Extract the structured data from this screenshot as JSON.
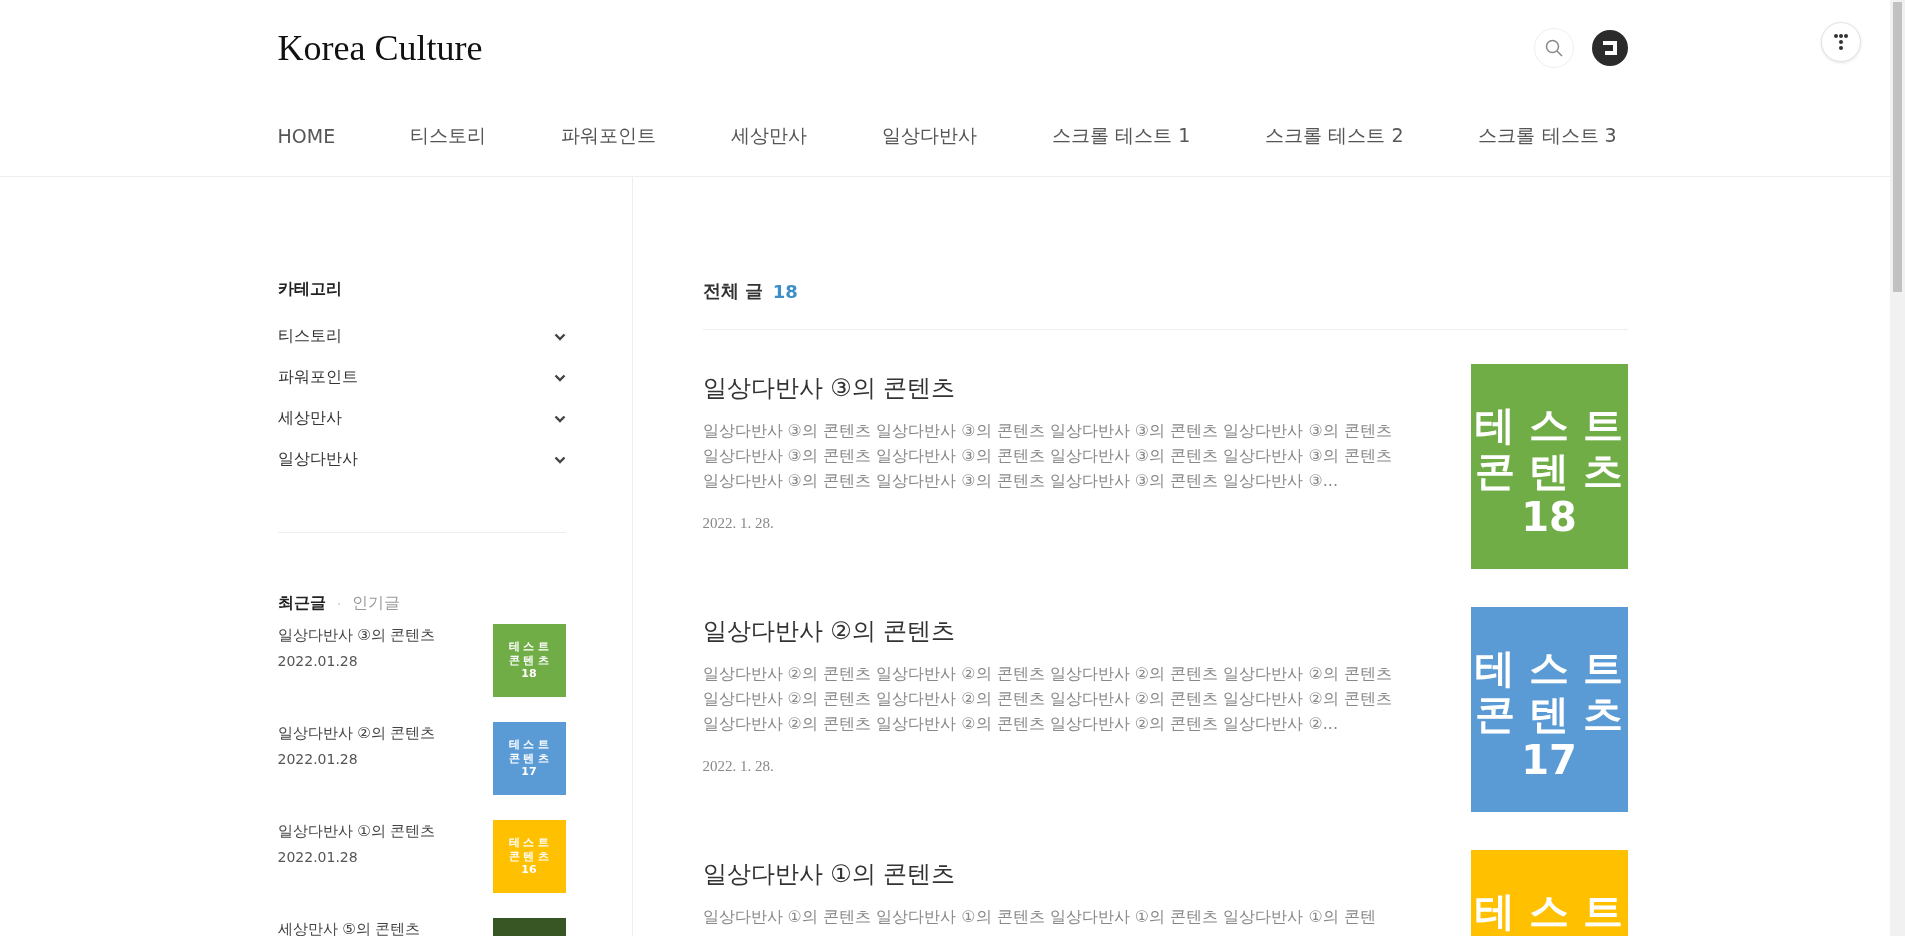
{
  "blog": {
    "title": "Korea Culture"
  },
  "nav": [
    {
      "label": "HOME"
    },
    {
      "label": "티스토리"
    },
    {
      "label": "파워포인트"
    },
    {
      "label": "세상만사"
    },
    {
      "label": "일상다반사"
    },
    {
      "label": "스크롤 테스트 1"
    },
    {
      "label": "스크롤 테스트 2"
    },
    {
      "label": "스크롤 테스트 3"
    }
  ],
  "sidebar": {
    "category_heading": "카테고리",
    "categories": [
      {
        "label": "티스토리"
      },
      {
        "label": "파워포인트"
      },
      {
        "label": "세상만사"
      },
      {
        "label": "일상다반사"
      }
    ],
    "tabs": [
      {
        "label": "최근글",
        "selected": true
      },
      {
        "label": "인기글",
        "selected": false
      }
    ],
    "recent_posts": [
      {
        "title": "일상다반사 ③의 콘텐츠",
        "date": "2022.01.28",
        "thumb": {
          "color": "#70ad47",
          "lines": [
            "테 스 트",
            "콘 텐 츠",
            "18"
          ]
        }
      },
      {
        "title": "일상다반사 ②의 콘텐츠",
        "date": "2022.01.28",
        "thumb": {
          "color": "#5b9bd5",
          "lines": [
            "테 스 트",
            "콘 텐 츠",
            "17"
          ]
        }
      },
      {
        "title": "일상다반사 ①의 콘텐츠",
        "date": "2022.01.28",
        "thumb": {
          "color": "#ffc000",
          "lines": [
            "테 스 트",
            "콘 텐 츠",
            "16"
          ]
        }
      },
      {
        "title": "세상만사 ⑤의 콘텐츠",
        "thumb": {
          "color": "#375623"
        }
      }
    ]
  },
  "main": {
    "heading": "전체 글",
    "count": "18",
    "posts": [
      {
        "title": "일상다반사 ③의 콘텐츠",
        "excerpt": "일상다반사 ③의 콘텐츠 일상다반사 ③의 콘텐츠 일상다반사 ③의 콘텐츠 일상다반사 ③의 콘텐츠 일상다반사 ③의 콘텐츠 일상다반사 ③의 콘텐츠 일상다반사 ③의 콘텐츠 일상다반사 ③의 콘텐츠 일상다반사 ③의 콘텐츠 일상다반사 ③의 콘텐츠 일상다반사 ③의 콘텐츠 일상다반사 ③...",
        "date": "2022. 1. 28.",
        "thumb": {
          "color": "#70ad47",
          "lines": [
            "테 스 트",
            "콘 텐 츠",
            "18"
          ]
        }
      },
      {
        "title": "일상다반사 ②의 콘텐츠",
        "excerpt": "일상다반사 ②의 콘텐츠 일상다반사 ②의 콘텐츠 일상다반사 ②의 콘텐츠 일상다반사 ②의 콘텐츠 일상다반사 ②의 콘텐츠 일상다반사 ②의 콘텐츠 일상다반사 ②의 콘텐츠 일상다반사 ②의 콘텐츠 일상다반사 ②의 콘텐츠 일상다반사 ②의 콘텐츠 일상다반사 ②의 콘텐츠 일상다반사 ②...",
        "date": "2022. 1. 28.",
        "thumb": {
          "color": "#5b9bd5",
          "lines": [
            "테 스 트",
            "콘 텐 츠",
            "17"
          ]
        }
      },
      {
        "title": "일상다반사 ①의 콘텐츠",
        "excerpt": "일상다반사 ①의 콘텐츠 일상다반사 ①의 콘텐츠 일상다반사 ①의 콘텐츠 일상다반사 ①의 콘텐",
        "thumb": {
          "color": "#ffc000",
          "lines": [
            "테 스 트"
          ]
        }
      }
    ]
  }
}
